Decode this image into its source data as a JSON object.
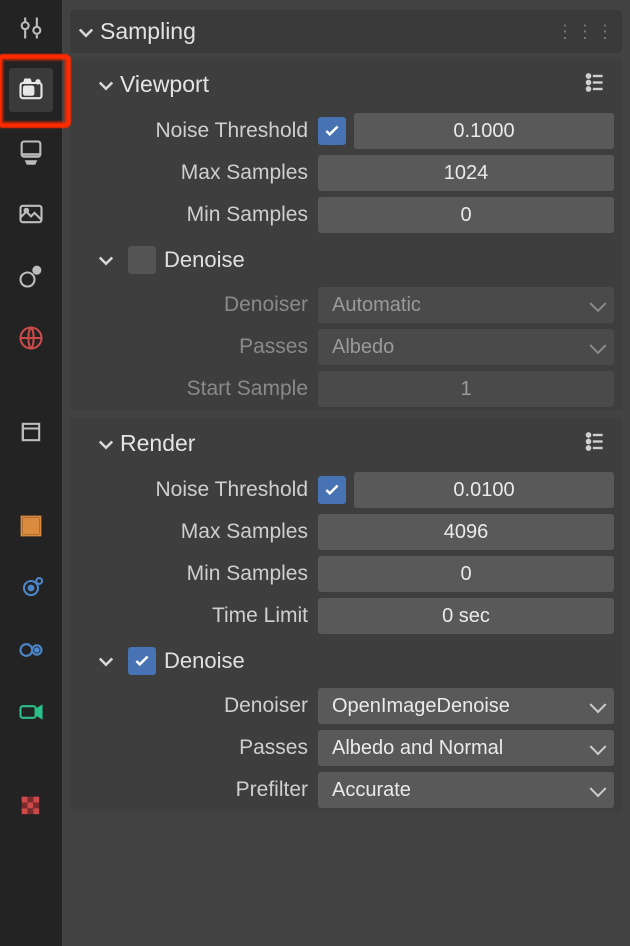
{
  "panel": {
    "sampling_label": "Sampling",
    "viewport": {
      "label": "Viewport",
      "noise_threshold_label": "Noise Threshold",
      "noise_threshold_checked": true,
      "noise_threshold_value": "0.1000",
      "max_samples_label": "Max Samples",
      "max_samples_value": "1024",
      "min_samples_label": "Min Samples",
      "min_samples_value": "0",
      "denoise": {
        "label": "Denoise",
        "checked": false,
        "denoiser_label": "Denoiser",
        "denoiser_value": "Automatic",
        "passes_label": "Passes",
        "passes_value": "Albedo",
        "start_sample_label": "Start Sample",
        "start_sample_value": "1"
      }
    },
    "render": {
      "label": "Render",
      "noise_threshold_label": "Noise Threshold",
      "noise_threshold_checked": true,
      "noise_threshold_value": "0.0100",
      "max_samples_label": "Max Samples",
      "max_samples_value": "4096",
      "min_samples_label": "Min Samples",
      "min_samples_value": "0",
      "time_limit_label": "Time Limit",
      "time_limit_value": "0 sec",
      "denoise": {
        "label": "Denoise",
        "checked": true,
        "denoiser_label": "Denoiser",
        "denoiser_value": "OpenImageDenoise",
        "passes_label": "Passes",
        "passes_value": "Albedo and Normal",
        "prefilter_label": "Prefilter",
        "prefilter_value": "Accurate"
      }
    }
  },
  "sidebar": {
    "tabs": [
      "tool",
      "render",
      "output",
      "viewlayer",
      "scene",
      "world",
      "object",
      "modifiers",
      "particles",
      "physics",
      "constraints",
      "material"
    ],
    "active": "render"
  },
  "colors": {
    "accent_highlight": "#ff2a00",
    "accent_check": "#4772b3",
    "icon_orange": "#db8b3d",
    "icon_blue": "#4a86c9",
    "icon_green": "#2bbf8a",
    "icon_red": "#cc4a4a",
    "icon_grey": "#bdbdbd"
  }
}
